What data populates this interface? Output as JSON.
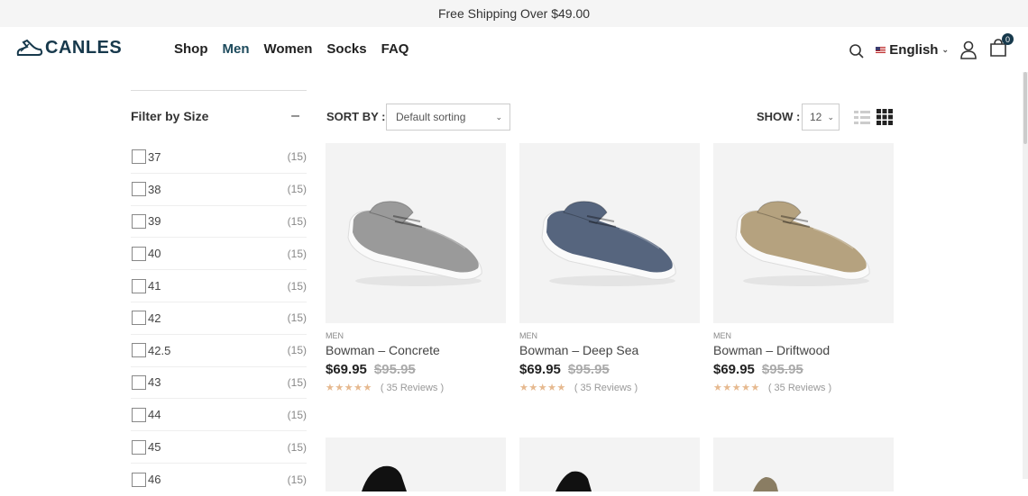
{
  "announcement": "Free Shipping Over $49.00",
  "logo": {
    "text": "CANLES",
    "color": "#17394c"
  },
  "nav": [
    {
      "label": "Shop",
      "active": false
    },
    {
      "label": "Men",
      "active": true
    },
    {
      "label": "Women",
      "active": false
    },
    {
      "label": "Socks",
      "active": false
    },
    {
      "label": "FAQ",
      "active": false
    }
  ],
  "language": "English",
  "cart_count": "0",
  "filter": {
    "title": "Filter by Size",
    "toggle": "–",
    "sizes": [
      {
        "label": "37",
        "count": "(15)"
      },
      {
        "label": "38",
        "count": "(15)"
      },
      {
        "label": "39",
        "count": "(15)"
      },
      {
        "label": "40",
        "count": "(15)"
      },
      {
        "label": "41",
        "count": "(15)"
      },
      {
        "label": "42",
        "count": "(15)"
      },
      {
        "label": "42.5",
        "count": "(15)"
      },
      {
        "label": "43",
        "count": "(15)"
      },
      {
        "label": "44",
        "count": "(15)"
      },
      {
        "label": "45",
        "count": "(15)"
      },
      {
        "label": "46",
        "count": "(15)"
      }
    ]
  },
  "toolbar": {
    "sort_label": "SORT BY :",
    "sort_value": "Default sorting",
    "show_label": "SHOW :",
    "show_value": "12"
  },
  "products": [
    {
      "category": "MEN",
      "name": "Bowman – Concrete",
      "price": "$69.95",
      "old_price": "$95.95",
      "stars": "★★★★★",
      "reviews": "( 35 Reviews )",
      "color": "#9a9a9a"
    },
    {
      "category": "MEN",
      "name": "Bowman – Deep Sea",
      "price": "$69.95",
      "old_price": "$95.95",
      "stars": "★★★★★",
      "reviews": "( 35 Reviews )",
      "color": "#56657e"
    },
    {
      "category": "MEN",
      "name": "Bowman – Driftwood",
      "price": "$69.95",
      "old_price": "$95.95",
      "stars": "★★★★★",
      "reviews": "( 35 Reviews )",
      "color": "#b5a27f"
    }
  ],
  "colors": {
    "accent": "#17394c",
    "star": "#e6b98f"
  },
  "icons": {
    "search": "search-icon",
    "user": "user-icon",
    "cart": "cart-icon",
    "list_view": "list-view-icon",
    "grid_view": "grid-view-icon"
  }
}
